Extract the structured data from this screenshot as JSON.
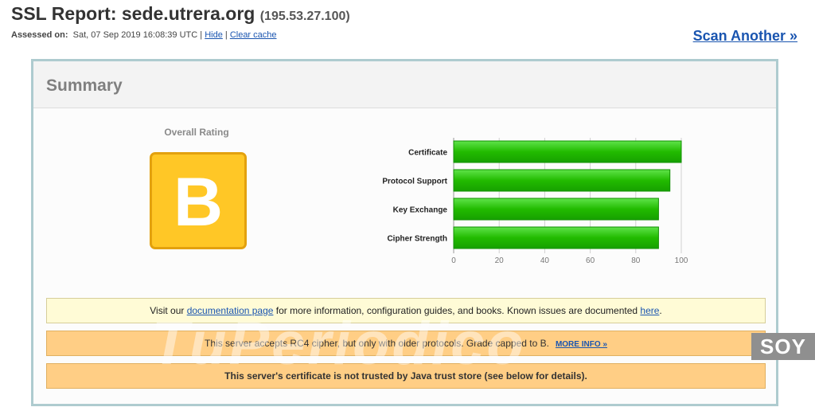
{
  "header": {
    "title_prefix": "SSL Report: ",
    "hostname": "sede.utrera.org",
    "ip": "(195.53.27.100)",
    "assessed_label": "Assessed on:",
    "assessed_date": "Sat, 07 Sep 2019 16:08:39 UTC",
    "separator": "|",
    "hide_link": "Hide",
    "clear_cache_link": "Clear cache",
    "scan_another": "Scan Another »"
  },
  "summary": {
    "title": "Summary",
    "overall_rating_label": "Overall Rating",
    "grade": "B",
    "grade_color": "#ffc726"
  },
  "chart_data": {
    "type": "bar",
    "orientation": "horizontal",
    "categories": [
      "Certificate",
      "Protocol Support",
      "Key Exchange",
      "Cipher Strength"
    ],
    "values": [
      100,
      95,
      90,
      90
    ],
    "xlim": [
      0,
      100
    ],
    "xticks": [
      0,
      20,
      40,
      60,
      80,
      100
    ],
    "grid": true,
    "bar_color": "#22bb00"
  },
  "notices": {
    "info": {
      "pre": "Visit our ",
      "doc_link": "documentation page",
      "mid": " for more information, configuration guides, and books. Known issues are documented ",
      "here_link": "here",
      "post": "."
    },
    "rc4": {
      "text": "This server accepts RC4 cipher, but only with older protocols. Grade capped to B.",
      "more_info": "MORE INFO »"
    },
    "java": {
      "text": "This server's certificate is not trusted by Java trust store (see below for details)."
    }
  },
  "watermark": {
    "text": "TuPeriodico",
    "badge": "SOY"
  }
}
